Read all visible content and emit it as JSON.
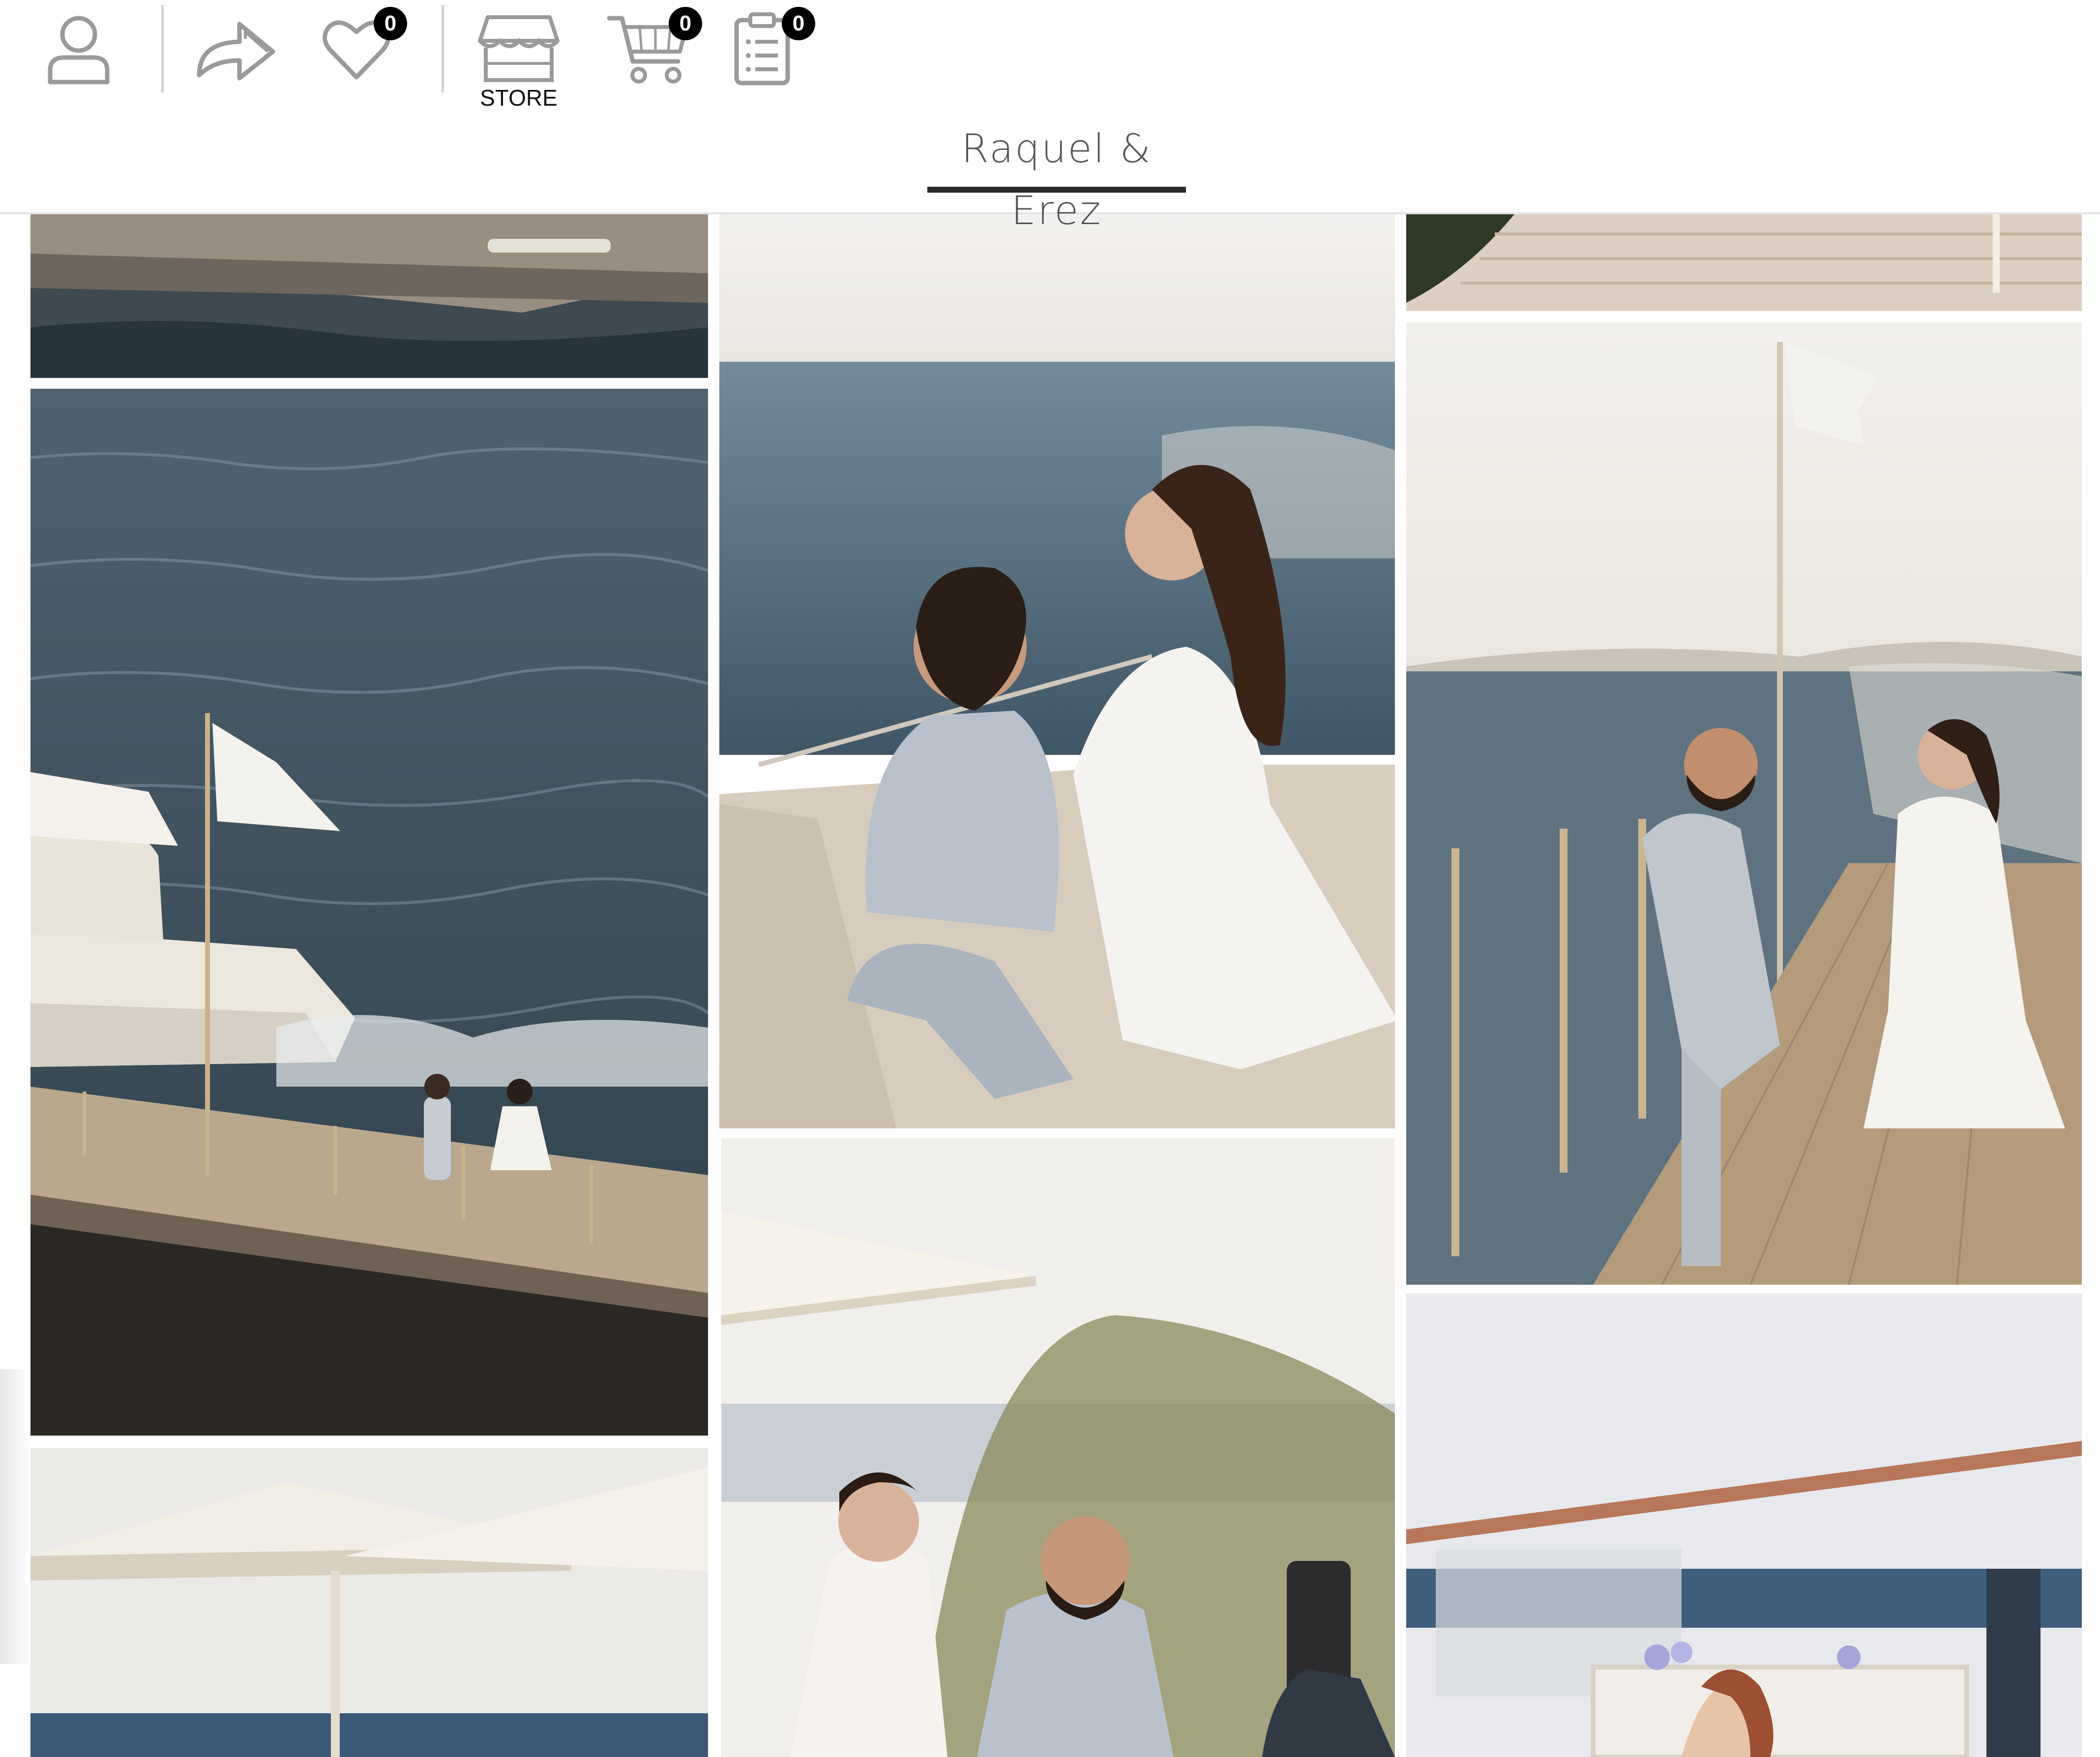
{
  "header": {
    "icons": {
      "account": "user-icon",
      "share": "share-arrow-icon",
      "favorites": "heart-icon",
      "store": "storefront-icon",
      "cart": "cart-icon",
      "orders": "clipboard-list-icon"
    },
    "favorites_count": "0",
    "store_label": "STORE",
    "cart_count": "0",
    "orders_count": "0"
  },
  "tabs": {
    "active_label": "Raquel & Erez"
  },
  "gallery": {
    "photos": [
      "pier-bottom-partial",
      "yacht-and-pier-aerial",
      "couple-sitting-on-yacht",
      "couple-walking-on-pier",
      "marble-steps-partial",
      "umbrellas-by-sea",
      "couple-walking-laughing",
      "easel-portrait-sketch-terrace"
    ]
  },
  "colors": {
    "badge": "#000000",
    "icon_stroke": "#9a9a9a",
    "tab_underline": "#2a2a2a",
    "tab_text": "#555555"
  }
}
